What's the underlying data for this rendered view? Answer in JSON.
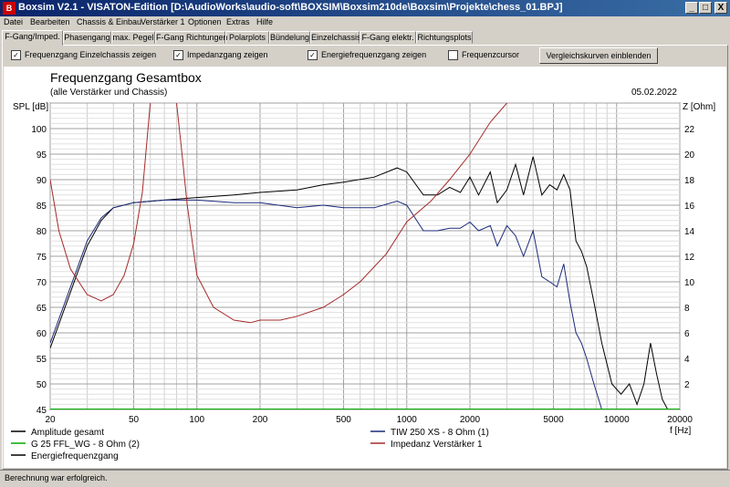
{
  "window": {
    "title": "Boxsim V2.1 - VISATON-Edition [D:\\AudioWorks\\audio-soft\\BOXSIM\\Boxsim210de\\Boxsim\\Projekte\\chess_01.BPJ]",
    "app_icon": "boxsim-app-icon",
    "minimize": "_",
    "maximize": "□",
    "close": "X"
  },
  "menu": [
    "Datei",
    "Bearbeiten",
    "Chassis & Einbau",
    "Verstärker 1",
    "Optionen",
    "Extras",
    "Hilfe"
  ],
  "tabs": [
    "F-Gang/Imped.",
    "Phasengang",
    "max. Pegel",
    "F-Gang Richtungen",
    "Polarplots",
    "Bündelung",
    "Einzelchassis",
    "F-Gang elektr.",
    "Richtungsplots"
  ],
  "active_tab": "F-Gang/Imped.",
  "options": {
    "chassis": {
      "label": "Frequenzgang Einzelchassis zeigen",
      "checked": true
    },
    "impedance": {
      "label": "Impedanzgang zeigen",
      "checked": true
    },
    "energy": {
      "label": "Energiefrequenzgang zeigen",
      "checked": true
    },
    "cursor": {
      "label": "Frequenzcursor",
      "checked": false
    },
    "compare_button": "Vergleichskurven einblenden"
  },
  "check_mark": "✓",
  "chart_data": {
    "type": "line",
    "title": "Frequenzgang Gesamtbox",
    "subtitle": "(alle Verstärker und Chassis)",
    "date": "05.02.2022",
    "ylabel_left": "SPL [dB]",
    "ylabel_right": "Z [Ohm]",
    "xlabel": "f [Hz]",
    "x_scale": "log",
    "xlim": [
      20,
      20000
    ],
    "ylim_left": [
      45,
      105
    ],
    "ylim_right": [
      0,
      24
    ],
    "x_ticks": [
      20,
      50,
      100,
      200,
      500,
      1000,
      2000,
      5000,
      10000,
      20000
    ],
    "y_left_ticks": [
      45,
      50,
      55,
      60,
      65,
      70,
      75,
      80,
      85,
      90,
      95,
      100
    ],
    "y_right_ticks": [
      2,
      4,
      6,
      8,
      10,
      12,
      14,
      16,
      18,
      20,
      22
    ],
    "grid": true,
    "legend_position": "bottom",
    "series": [
      {
        "name": "Amplitude gesamt",
        "color": "#000000",
        "axis": "left",
        "x": [
          20,
          25,
          30,
          35,
          40,
          50,
          70,
          100,
          150,
          200,
          300,
          400,
          500,
          700,
          900,
          1000,
          1200,
          1400,
          1600,
          1800,
          2000,
          2200,
          2500,
          2700,
          3000,
          3300,
          3600,
          4000,
          4400,
          4800,
          5200,
          5600,
          6000,
          6400,
          6800,
          7200,
          7800,
          8500,
          9500,
          10500,
          11500,
          12500,
          13500,
          14500,
          15500,
          16500,
          17500,
          18000
        ],
        "y": [
          57,
          68,
          77,
          82,
          84.5,
          85.5,
          86,
          86.5,
          87,
          87.5,
          88,
          89,
          89.5,
          90.5,
          92.3,
          91.5,
          87,
          87,
          88.5,
          87.5,
          90.5,
          87,
          91.5,
          85.5,
          88,
          93,
          87,
          94.5,
          87,
          89,
          88,
          91,
          88,
          78,
          76,
          73,
          66,
          58,
          50,
          48,
          50,
          46,
          50,
          58,
          52,
          47,
          45,
          44
        ]
      },
      {
        "name": "TIW 250 XS - 8 Ohm (1)",
        "color": "#1a2a7a",
        "axis": "left",
        "x": [
          20,
          25,
          30,
          35,
          40,
          50,
          70,
          100,
          150,
          200,
          300,
          400,
          500,
          700,
          900,
          1000,
          1200,
          1400,
          1600,
          1800,
          2000,
          2200,
          2500,
          2700,
          3000,
          3300,
          3600,
          4000,
          4400,
          4800,
          5200,
          5600,
          6000,
          6400,
          6800,
          7200,
          7800,
          8500,
          9000
        ],
        "y": [
          58,
          69,
          78,
          82.5,
          84.5,
          85.5,
          86,
          86,
          85.5,
          85.5,
          84.5,
          85,
          84.5,
          84.5,
          85.8,
          85,
          80,
          80,
          80.5,
          80.5,
          81.7,
          80,
          81,
          77,
          81,
          79,
          75,
          80,
          71,
          70,
          69,
          73.5,
          66,
          60,
          58,
          55,
          50,
          45,
          44
        ]
      },
      {
        "name": "G 25 FFL_WG - 8 Ohm (2)",
        "color": "#00aa00",
        "axis": "left",
        "x": [
          20,
          20000
        ],
        "y": [
          45,
          45
        ]
      },
      {
        "name": "Impedanz Verstärker 1",
        "color": "#a52a2a",
        "axis": "right",
        "x": [
          20,
          22,
          25,
          30,
          35,
          40,
          45,
          50,
          55,
          60,
          65,
          70,
          75,
          80,
          85,
          90,
          100,
          120,
          150,
          180,
          200,
          250,
          300,
          400,
          500,
          600,
          800,
          1000,
          1300,
          1600,
          2000,
          2500,
          3000,
          3500,
          3800,
          20000
        ],
        "y": [
          18,
          14,
          11,
          9,
          8.5,
          9,
          10.5,
          13,
          17,
          24,
          25,
          25,
          25,
          24,
          20,
          16,
          10.5,
          8,
          7,
          6.8,
          7,
          7,
          7.3,
          8,
          9,
          10,
          12.2,
          14.7,
          16.3,
          18,
          20,
          22.5,
          24,
          25,
          25,
          25
        ]
      },
      {
        "name": "Energiefrequenzgang",
        "color": "#000000",
        "axis": "left",
        "x": [],
        "y": []
      }
    ]
  },
  "status": "Berechnung war erfolgreich."
}
